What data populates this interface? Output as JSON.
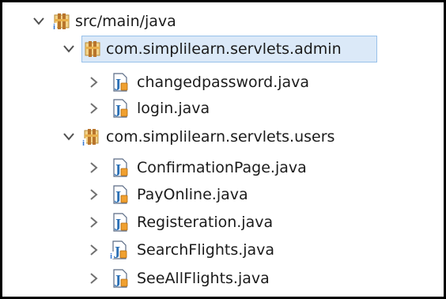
{
  "tree": {
    "source_folder": {
      "label": "src/main/java",
      "icon": "package-folder-icon",
      "expanded": true
    },
    "packages": [
      {
        "label": "com.simplilearn.servlets.admin",
        "icon": "package-icon",
        "expanded": true,
        "selected": true,
        "files": [
          {
            "label": "changedpassword.java",
            "icon": "java-file-icon"
          },
          {
            "label": "login.java",
            "icon": "java-file-icon"
          }
        ]
      },
      {
        "label": "com.simplilearn.servlets.users",
        "icon": "package-info-icon",
        "expanded": true,
        "selected": false,
        "files": [
          {
            "label": "ConfirmationPage.java",
            "icon": "java-file-icon"
          },
          {
            "label": "PayOnline.java",
            "icon": "java-file-icon"
          },
          {
            "label": "Registeration.java",
            "icon": "java-file-icon"
          },
          {
            "label": "SearchFlights.java",
            "icon": "java-file-info-icon"
          },
          {
            "label": "SeeAllFlights.java",
            "icon": "java-file-icon"
          }
        ]
      }
    ]
  },
  "colors": {
    "selection_bg": "#dbe9f8",
    "selection_border": "#99c1ea",
    "package_brown": "#b9752c",
    "package_gold": "#e8b04c",
    "java_blue": "#2a6fb5",
    "java_orange": "#f0a030"
  }
}
